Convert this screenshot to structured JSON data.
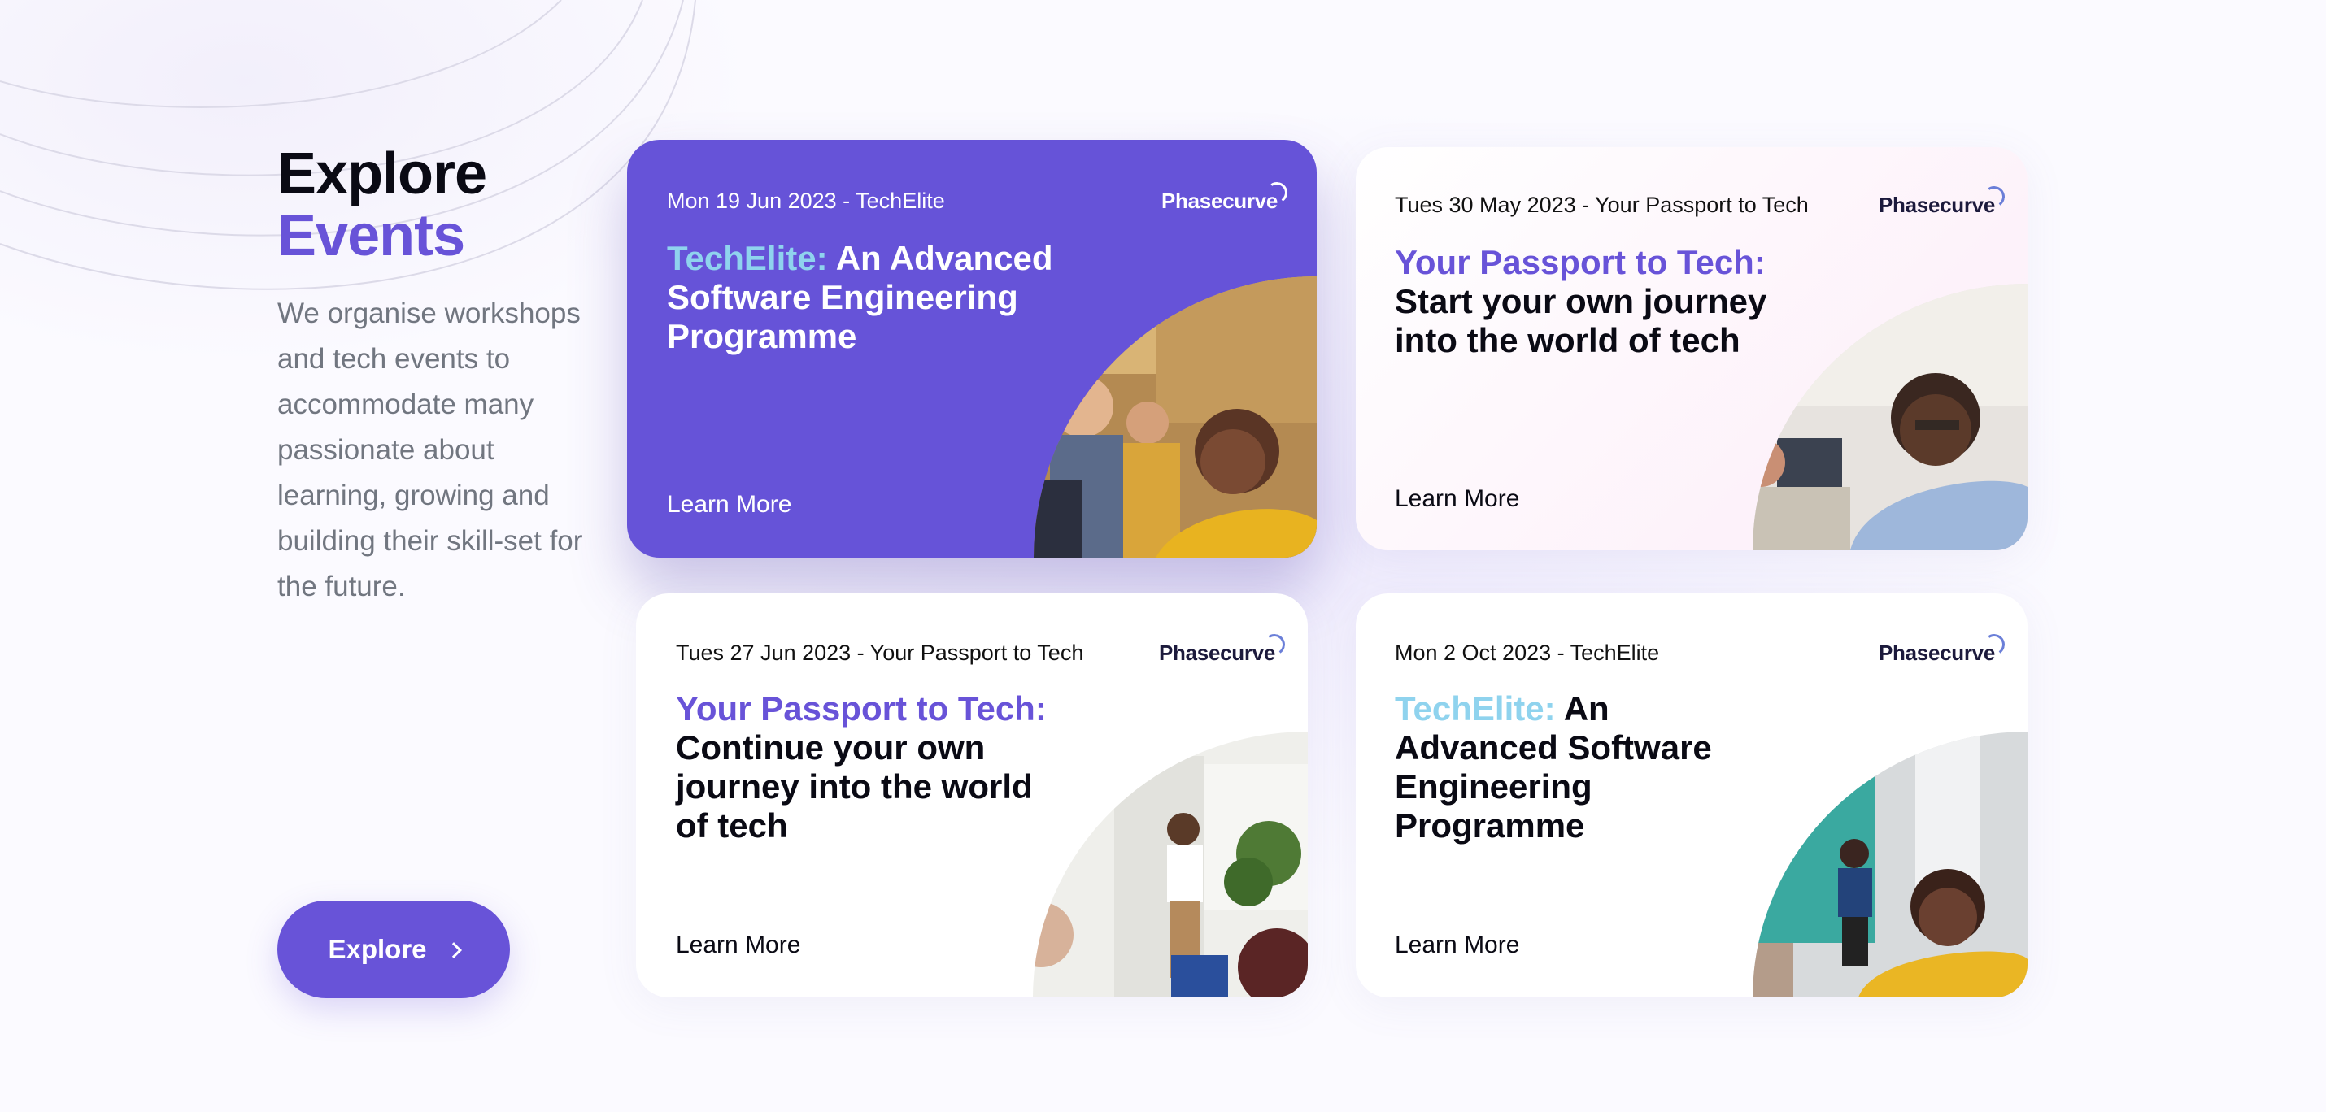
{
  "intro": {
    "heading_line1": "Explore",
    "heading_line2": "Events",
    "description": "We organise workshops and tech events to accommodate many passionate about learning, growing and building their skill-set for the future.",
    "explore_label": "Explore"
  },
  "colors": {
    "accent": "#6853d8",
    "highlight_light": "#8fd3ee",
    "text_dark": "#0a0a14",
    "muted": "#717680"
  },
  "cards": [
    {
      "date": "Mon 19 Jun 2023 - TechElite",
      "brand": "Phasecurve",
      "title_highlight": "TechElite:",
      "title_rest": " An Advanced Software Engineering Programme",
      "learn_more": "Learn More"
    },
    {
      "date": "Tues 30 May 2023 - Your Passport to Tech",
      "brand": "Phasecurve",
      "title_highlight": "Your Passport to Tech:",
      "title_rest": "Start your own journey into the world of tech",
      "learn_more": "Learn More"
    },
    {
      "date": "Tues 27 Jun 2023 - Your Passport to Tech",
      "brand": "Phasecurve",
      "title_highlight": "Your Passport to Tech:",
      "title_rest": "Continue your own journey into the world of tech",
      "learn_more": "Learn More"
    },
    {
      "date": "Mon 2 Oct 2023 - TechElite",
      "brand": "Phasecurve",
      "title_highlight": "TechElite:",
      "title_rest": " An Advanced Software Engineering Programme",
      "learn_more": "Learn More"
    }
  ]
}
